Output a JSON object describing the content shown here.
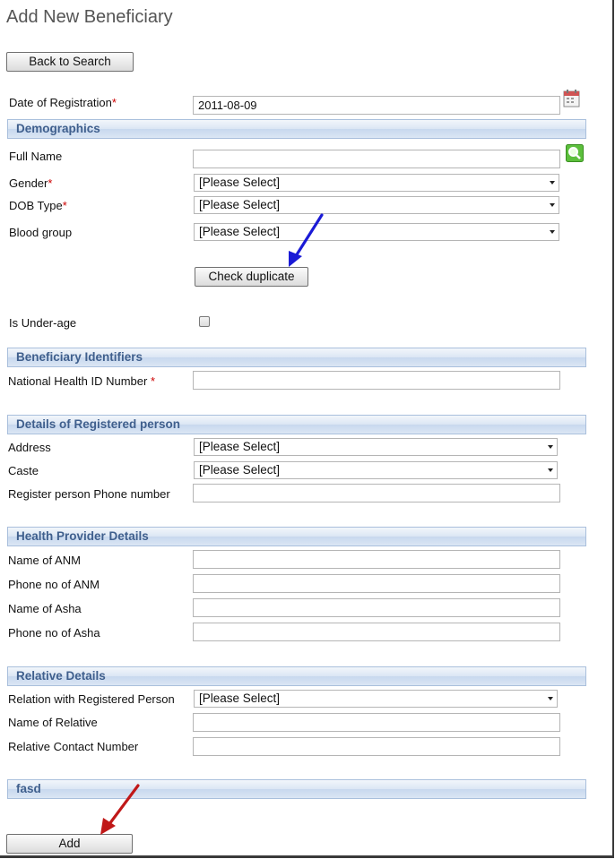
{
  "page": {
    "title": "Add New Beneficiary"
  },
  "buttons": {
    "back": "Back to Search",
    "check_duplicate": "Check duplicate",
    "add": "Add"
  },
  "registration": {
    "label": "Date of Registration",
    "required": "*",
    "value": "2011-08-09"
  },
  "demographics": {
    "header": "Demographics",
    "full_name_label": "Full Name",
    "full_name_value": "",
    "gender_label": "Gender",
    "gender_value": "[Please Select]",
    "dob_type_label": "DOB Type",
    "dob_type_value": "[Please Select]",
    "blood_group_label": "Blood group",
    "blood_group_value": "[Please Select]",
    "under_age_label": "Is Under-age",
    "under_age_checked": false,
    "required": "*"
  },
  "identifiers": {
    "header": "Beneficiary Identifiers",
    "nhid_label": "National Health ID Number",
    "required": "*",
    "nhid_value": ""
  },
  "registered_person": {
    "header": "Details of Registered person",
    "address_label": "Address",
    "address_value": "[Please Select]",
    "caste_label": "Caste",
    "caste_value": "[Please Select]",
    "phone_label": "Register person Phone number",
    "phone_value": ""
  },
  "health_provider": {
    "header": "Health Provider Details",
    "anm_name_label": "Name of ANM",
    "anm_phone_label": "Phone no of ANM",
    "asha_name_label": "Name of Asha",
    "asha_phone_label": "Phone no of Asha"
  },
  "relative": {
    "header": "Relative Details",
    "relation_label": "Relation with Registered Person",
    "relation_value": "[Please Select]",
    "name_label": "Name of Relative",
    "contact_label": "Relative Contact Number"
  },
  "extra_section": {
    "header": "fasd"
  },
  "colors": {
    "section_text": "#3f5f8d",
    "required_star": "#cc0000",
    "arrow_blue": "#1a1ad6",
    "arrow_red": "#c01818"
  },
  "icons": [
    "calendar-icon",
    "search-icon",
    "dropdown-arrow-icon",
    "pointer-arrow-annotation"
  ]
}
